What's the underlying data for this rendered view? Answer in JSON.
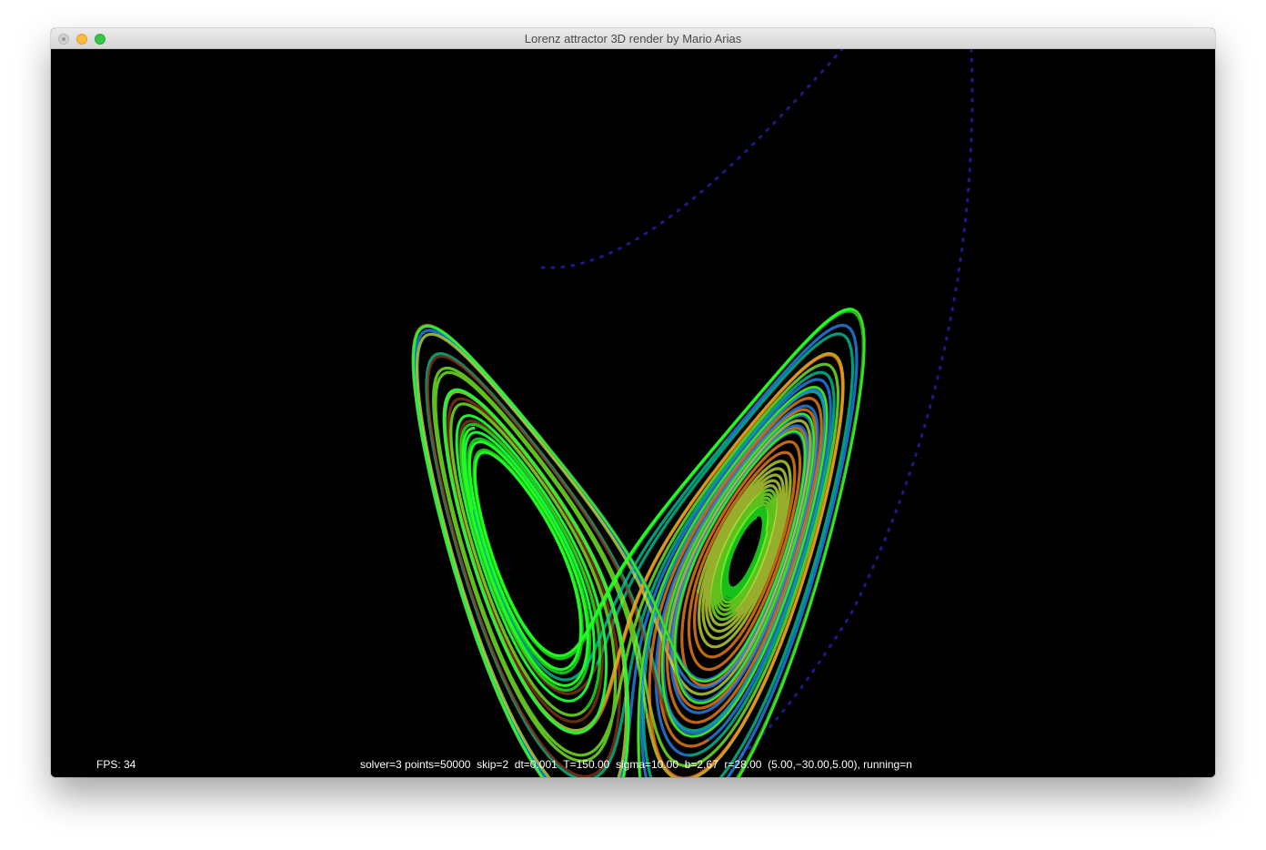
{
  "window": {
    "title": "Lorenz attractor 3D render by Mario Arias"
  },
  "hud": {
    "fps": "FPS: 34",
    "status": "solver=3 points=50000  skip=2  dt=0.001  T=150.00  sigma=10.00  b=2.67  r=28.00  (5.00,−30.00,5.00), running=n"
  },
  "simulation": {
    "solver": 3,
    "points": 50000,
    "skip": 2,
    "dt": 0.001,
    "T": 150.0,
    "sigma": 10.0,
    "b": 2.67,
    "r": 28.0,
    "initial_point": [
      5.0,
      -30.0,
      5.0
    ],
    "running": "n"
  },
  "colors": {
    "background": "#000000",
    "trail_palette": [
      "#22ff22",
      "#7fff2a",
      "#c8e83a",
      "#ff8a1a",
      "#2a8cff",
      "#00d0a0",
      "#8a3a1a"
    ],
    "transient_path": "#1a1a8a"
  },
  "icons": {
    "close": "close-button-icon",
    "minimize": "minimize-button-icon",
    "maximize": "zoom-button-icon"
  }
}
